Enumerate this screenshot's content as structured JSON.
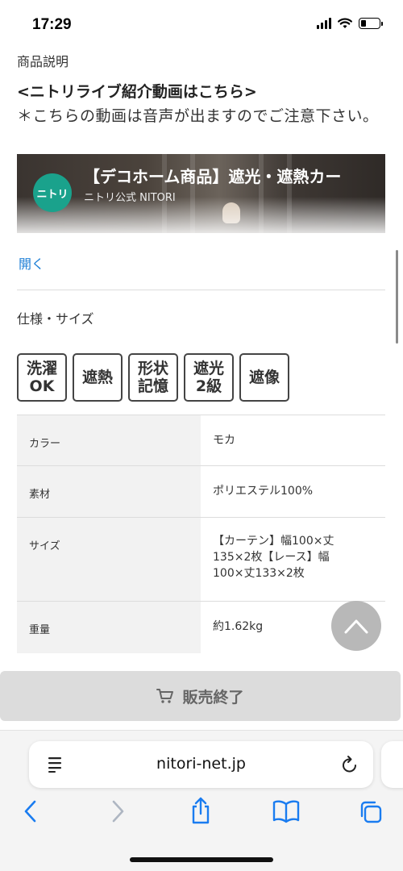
{
  "status_bar": {
    "time": "17:29"
  },
  "section": {
    "description_label": "商品説明",
    "video_heading": "<ニトリライブ紹介動画はこちら>",
    "video_note": "＊こちらの動画は音声が出ますのでご注意下さい。"
  },
  "video": {
    "logo_text": "ニトリ",
    "title": "【デコホーム商品】遮光・遮熱カー",
    "channel": "ニトリ公式 NITORI"
  },
  "open_link": "開く",
  "specs_label": "仕様・サイズ",
  "badges": [
    {
      "line1": "洗濯",
      "line2": "OK"
    },
    {
      "line1": "遮熱",
      "line2": ""
    },
    {
      "line1": "形状",
      "line2": "記憶"
    },
    {
      "line1": "遮光",
      "line2": "2級"
    },
    {
      "line1": "遮像",
      "line2": ""
    }
  ],
  "spec_rows": [
    {
      "key": "カラー",
      "value": "モカ"
    },
    {
      "key": "素材",
      "value": "ポリエステル100%"
    },
    {
      "key": "サイズ",
      "value": "【カーテン】幅100×丈135×2枚【レース】幅100×丈133×2枚"
    },
    {
      "key": "重量",
      "value": "約1.62kg"
    }
  ],
  "purchase_button": {
    "label": "販売終了",
    "icon": "cart-icon"
  },
  "browser": {
    "url": "nitori-net.jp"
  },
  "colors": {
    "link": "#1d7fd6",
    "logo_green": "#1aa28c",
    "button_gray": "#dcdcdc"
  }
}
